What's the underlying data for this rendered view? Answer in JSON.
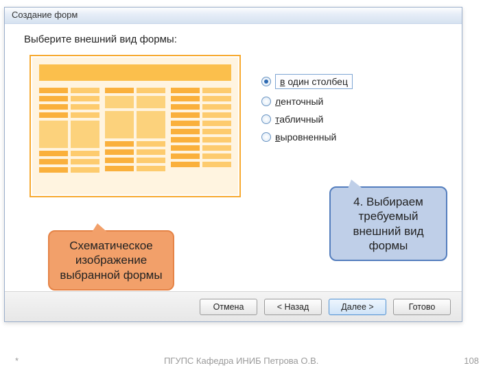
{
  "window": {
    "title": "Создание форм",
    "subtitle": "Выберите внешний вид формы:"
  },
  "options": [
    {
      "label": "в один столбец",
      "hotkey": "в",
      "selected": true
    },
    {
      "label": "ленточный",
      "hotkey": "л",
      "selected": false
    },
    {
      "label": "табличный",
      "hotkey": "т",
      "selected": false
    },
    {
      "label": "выровненный",
      "hotkey": "в",
      "selected": false
    }
  ],
  "buttons": {
    "cancel": "Отмена",
    "back": "< Назад",
    "next": "Далее >",
    "finish": "Готово"
  },
  "callouts": {
    "preview_note": "Схематическое изображение выбранной формы",
    "step_note": "4. Выбираем требуемый внешний вид формы"
  },
  "footer": {
    "left": "*",
    "center": "ПГУПС   Кафедра  ИНИБ   Петрова О.В.",
    "right": "108"
  }
}
